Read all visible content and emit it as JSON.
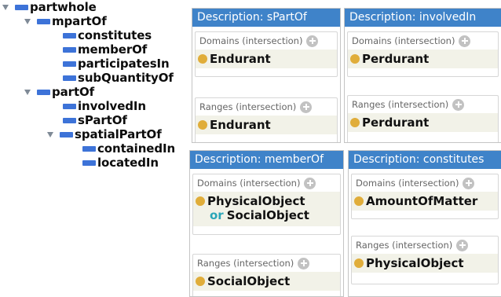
{
  "tree": {
    "root": "partwhole",
    "mpartOf": "mpartOf",
    "constitutes": "constitutes",
    "memberOf": "memberOf",
    "participatesIn": "participatesIn",
    "subQuantityOf": "subQuantityOf",
    "partOf": "partOf",
    "involvedIn": "involvedIn",
    "sPartOf": "sPartOf",
    "spatialPartOf": "spatialPartOf",
    "containedIn": "containedIn",
    "locatedIn": "locatedIn"
  },
  "panels": {
    "spartof": {
      "title": "Description: sPartOf",
      "domains_label": "Domains (intersection)",
      "domain": "Endurant",
      "ranges_label": "Ranges (intersection)",
      "range": "Endurant"
    },
    "involvedin": {
      "title": "Description: involvedIn",
      "domains_label": "Domains (intersection)",
      "domain": "Perdurant",
      "ranges_label": "Ranges (intersection)",
      "range": "Perdurant"
    },
    "memberof": {
      "title": "Description: memberOf",
      "domains_label": "Domains (intersection)",
      "domain_first": "PhysicalObject",
      "domain_or": "or",
      "domain_second": "SocialObject",
      "ranges_label": "Ranges (intersection)",
      "range": "SocialObject"
    },
    "constitutes": {
      "title": "Description: constitutes",
      "domains_label": "Domains (intersection)",
      "domain": "AmountOfMatter",
      "ranges_label": "Ranges (intersection)",
      "range": "PhysicalObject"
    }
  },
  "colors": {
    "title_bar": "#3f83c9",
    "property_bar": "#3d73d8",
    "class_dot": "#e0ad3a",
    "or_keyword": "#2aa6b8"
  }
}
